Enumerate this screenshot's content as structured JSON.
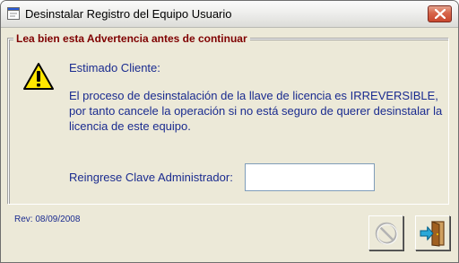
{
  "window": {
    "title": "Desinstalar Registro del Equipo Usuario",
    "app_icon": "app-icon",
    "close_icon": "close-icon"
  },
  "warning": {
    "group_title": "Lea bien esta Advertencia antes de continuar",
    "icon": "warning-icon",
    "greeting": "Estimado Cliente:",
    "message": "El proceso de desinstalación de la llave de licencia es IRREVERSIBLE, por tanto cancele la operación si no está seguro de querer desinstalar la licencia de este equipo."
  },
  "password": {
    "label": "Reingrese Clave Administrador:",
    "value": ""
  },
  "footer": {
    "revision": "Rev: 08/09/2008"
  },
  "buttons": {
    "cancel_icon": "cancel-icon",
    "exit_icon": "exit-door-icon",
    "cancel_enabled": false
  },
  "colors": {
    "legend_text": "#7f0000",
    "body_text": "#1a2b8f",
    "dialog_bg": "#ece9d8",
    "close_button": "#d7654a"
  }
}
